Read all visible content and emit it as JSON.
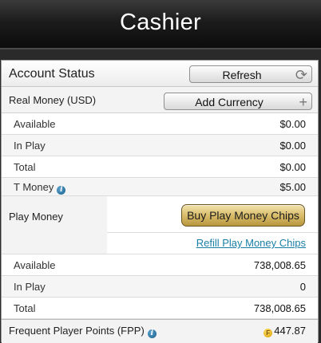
{
  "window": {
    "title": "Cashier"
  },
  "account_status": {
    "label": "Account Status",
    "refresh_label": "Refresh"
  },
  "real_money": {
    "label": "Real Money (USD)",
    "add_currency_label": "Add Currency",
    "rows": [
      {
        "label": "Available",
        "value": "$0.00"
      },
      {
        "label": "In Play",
        "value": "$0.00"
      },
      {
        "label": "Total",
        "value": "$0.00"
      }
    ],
    "t_money": {
      "label": "T Money",
      "value": "$5.00"
    }
  },
  "play_money": {
    "label": "Play Money",
    "buy_label": "Buy Play Money Chips",
    "refill_label": "Refill Play Money Chips",
    "rows": [
      {
        "label": "Available",
        "value": "738,008.65"
      },
      {
        "label": "In Play",
        "value": "0"
      },
      {
        "label": "Total",
        "value": "738,008.65"
      }
    ]
  },
  "fpp": {
    "label": "Frequent Player Points (FPP)",
    "value": "447.87",
    "coin_glyph": "F"
  },
  "icons": {
    "info": "i",
    "refresh": "⟳",
    "plus": "+"
  }
}
